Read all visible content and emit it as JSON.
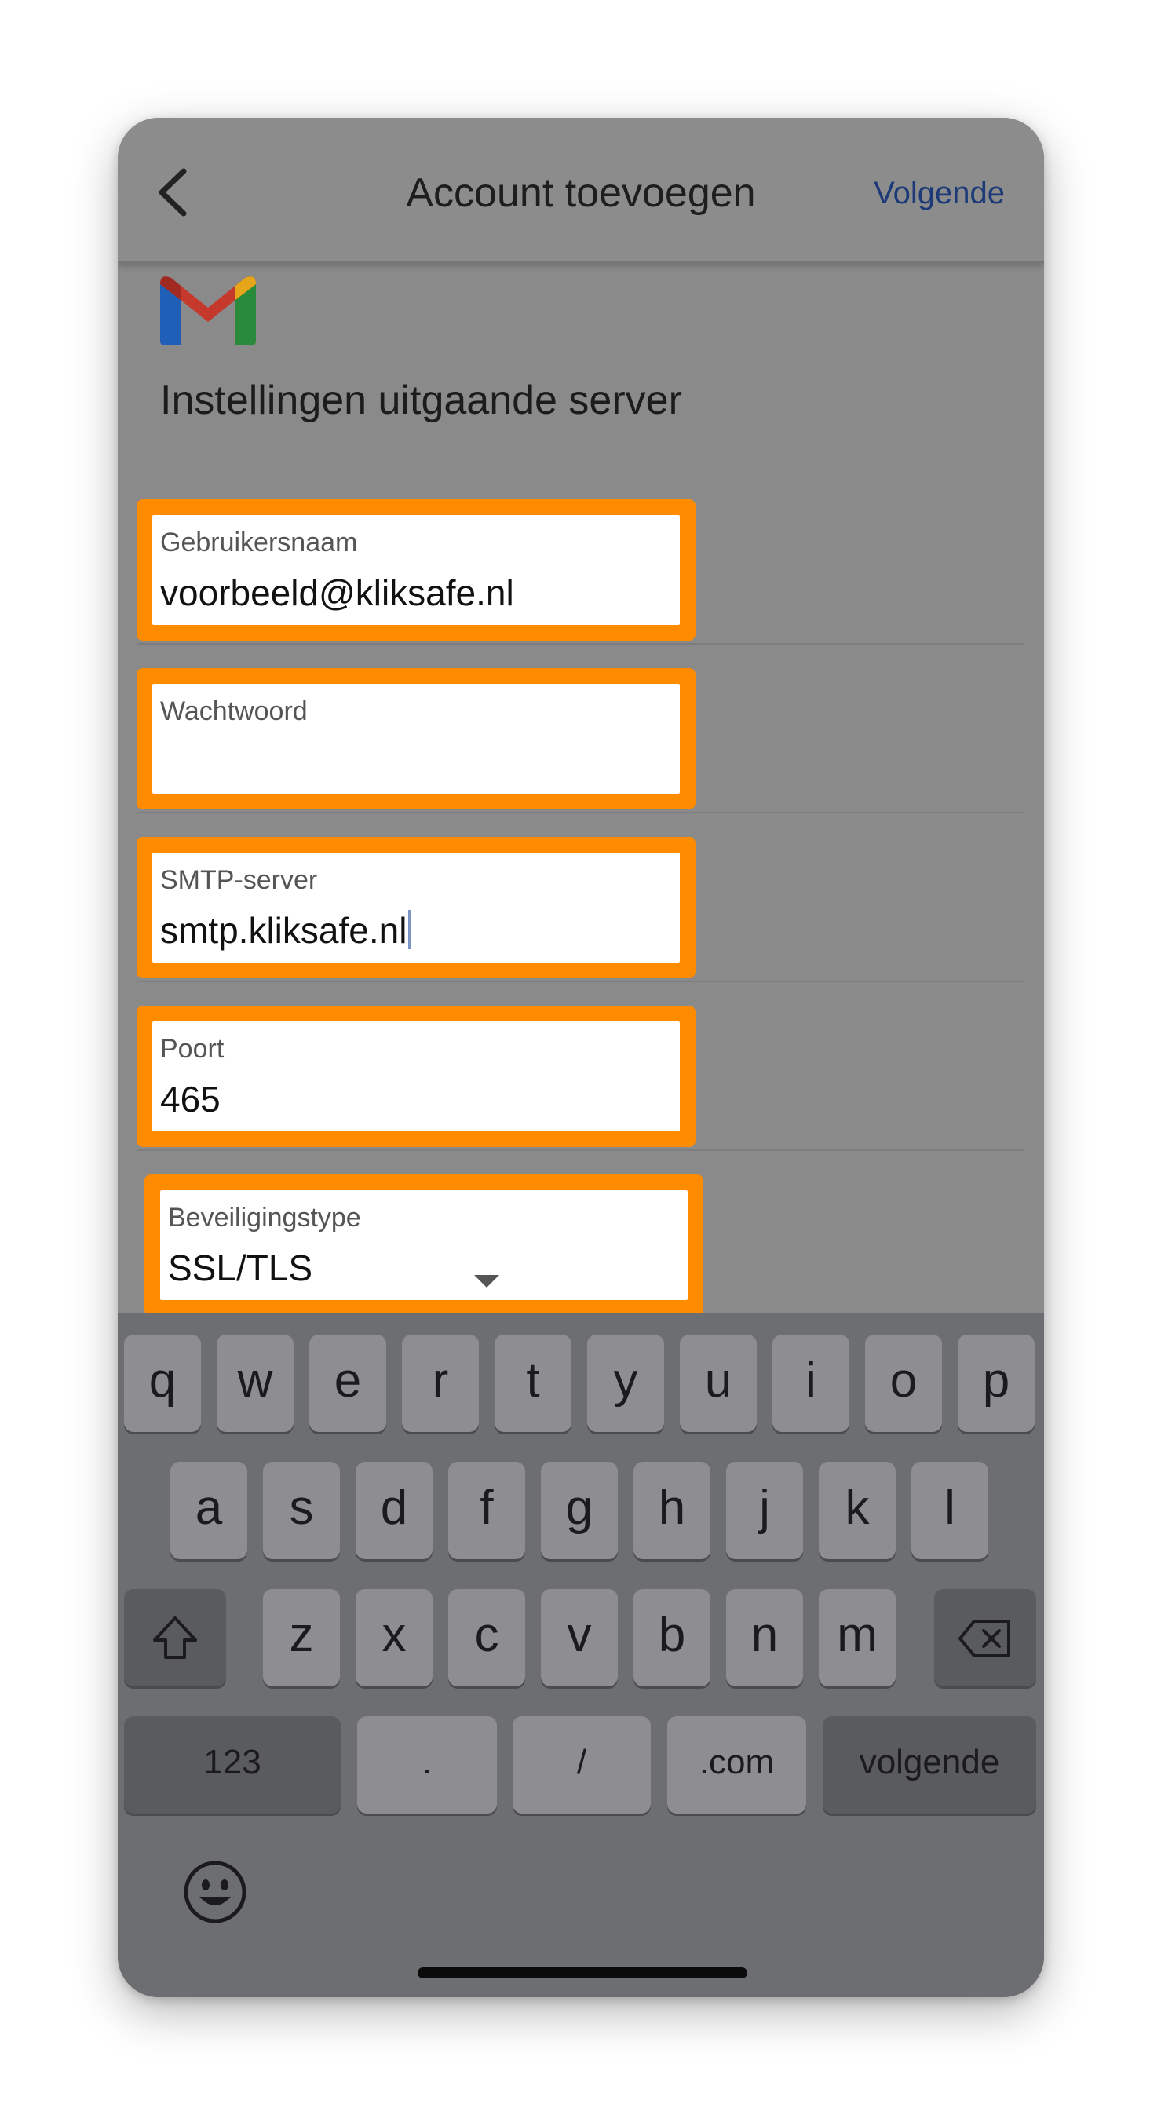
{
  "header": {
    "title": "Account toevoegen",
    "next_label": "Volgende",
    "back_icon": "chevron-left-icon"
  },
  "logo": {
    "name": "gmail-logo-icon"
  },
  "section": {
    "title": "Instellingen uitgaande server"
  },
  "fields": {
    "username": {
      "label": "Gebruikersnaam",
      "value": "voorbeeld@kliksafe.nl"
    },
    "password": {
      "label": "Wachtwoord",
      "value": ""
    },
    "smtp": {
      "label": "SMTP-server",
      "value": "smtp.kliksafe.nl"
    },
    "port": {
      "label": "Poort",
      "value": "465"
    },
    "security": {
      "label": "Beveiligingstype",
      "value": "SSL/TLS"
    }
  },
  "highlight_color": "#ff8c00",
  "keyboard": {
    "row1": [
      "q",
      "w",
      "e",
      "r",
      "t",
      "y",
      "u",
      "i",
      "o",
      "p"
    ],
    "row2": [
      "a",
      "s",
      "d",
      "f",
      "g",
      "h",
      "j",
      "k",
      "l"
    ],
    "row3": [
      "z",
      "x",
      "c",
      "v",
      "b",
      "n",
      "m"
    ],
    "row3_shift_icon": "shift-icon",
    "row3_delete_icon": "backspace-icon",
    "row4": {
      "numbers": "123",
      "dot": ".",
      "slash": "/",
      "dotcom": ".com",
      "return": "volgende"
    },
    "emoji_icon": "emoji-icon"
  }
}
